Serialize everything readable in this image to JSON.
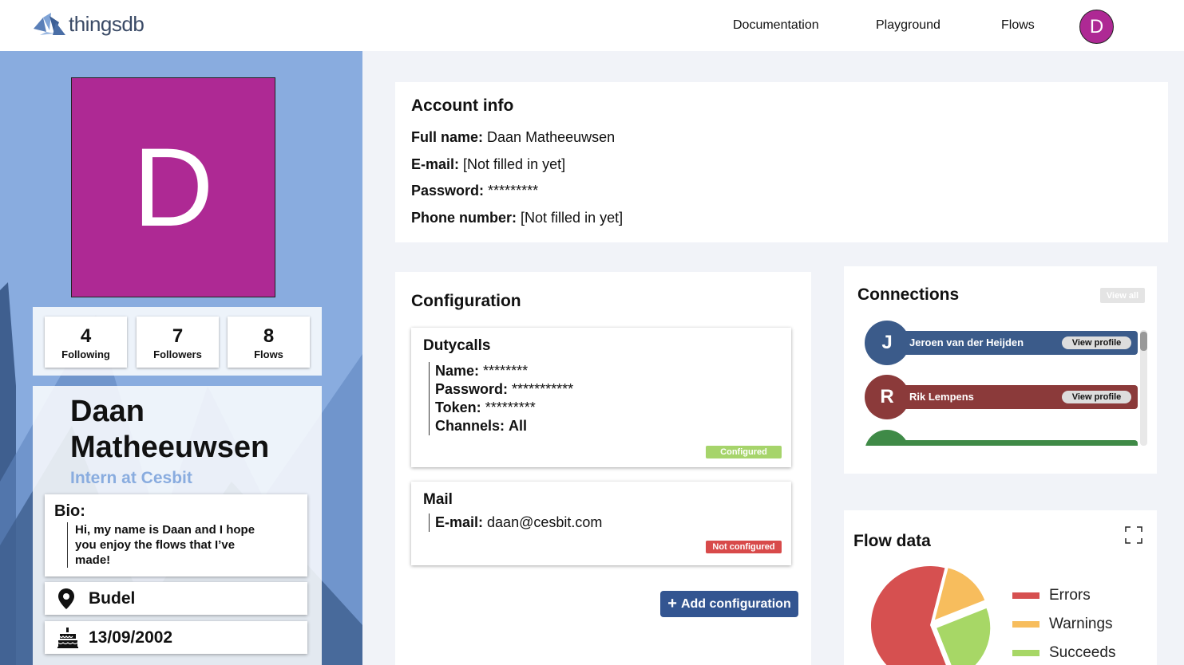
{
  "header": {
    "logo_text": "thingsdb",
    "nav": [
      "Documentation",
      "Playground",
      "Flows"
    ],
    "avatar_letter": "D"
  },
  "profile": {
    "avatar_letter": "D",
    "avatar_color": "#ae2994",
    "stats": [
      {
        "value": "4",
        "label": "Following"
      },
      {
        "value": "7",
        "label": "Followers"
      },
      {
        "value": "8",
        "label": "Flows"
      }
    ],
    "name": "Daan Matheeuwsen",
    "role": "Intern at Cesbit",
    "bio_title": "Bio:",
    "bio": "Hi, my name is Daan and I hope you enjoy the flows that I’ve made!",
    "location": "Budel",
    "birthday": "13/09/2002"
  },
  "account": {
    "title": "Account info",
    "rows": [
      {
        "label": "Full name:",
        "value": "Daan Matheeuwsen"
      },
      {
        "label": "E-mail:",
        "value": "[Not filled in yet]"
      },
      {
        "label": "Password:",
        "value": "*********"
      },
      {
        "label": "Phone number:",
        "value": "[Not filled in yet]"
      }
    ]
  },
  "configuration": {
    "title": "Configuration",
    "items": [
      {
        "title": "Dutycalls",
        "lines": [
          {
            "label": "Name:",
            "value": "********"
          },
          {
            "label": "Password:",
            "value": "***********"
          },
          {
            "label": "Token:",
            "value": "*********"
          },
          {
            "label": "Channels:",
            "value": "All"
          }
        ],
        "status": "Configured",
        "status_color": "#a6d46b"
      },
      {
        "title": "Mail",
        "lines": [
          {
            "label": "E-mail:",
            "value": "daan@cesbit.com"
          }
        ],
        "status": "Not configured",
        "status_color": "#d84a4a"
      }
    ],
    "add_label": "Add configuration"
  },
  "connections": {
    "title": "Connections",
    "view_all": "View all",
    "items": [
      {
        "letter": "J",
        "name": "Jeroen van der Heijden",
        "button": "View profile",
        "color": "#3b5b8a"
      },
      {
        "letter": "R",
        "name": "Rik Lempens",
        "button": "View profile",
        "color": "#8b3a3a"
      },
      {
        "letter": "",
        "name": "",
        "button": "",
        "color": "#3f8a47"
      }
    ]
  },
  "flow_data": {
    "title": "Flow data",
    "legend": [
      {
        "label": "Errors",
        "color": "#d65050"
      },
      {
        "label": "Warnings",
        "color": "#f7bd5d"
      },
      {
        "label": "Succeeds",
        "color": "#a7d766"
      }
    ]
  },
  "chart_data": {
    "type": "pie",
    "categories": [
      "Errors",
      "Warnings",
      "Succeeds"
    ],
    "values": [
      60,
      15,
      25
    ]
  }
}
